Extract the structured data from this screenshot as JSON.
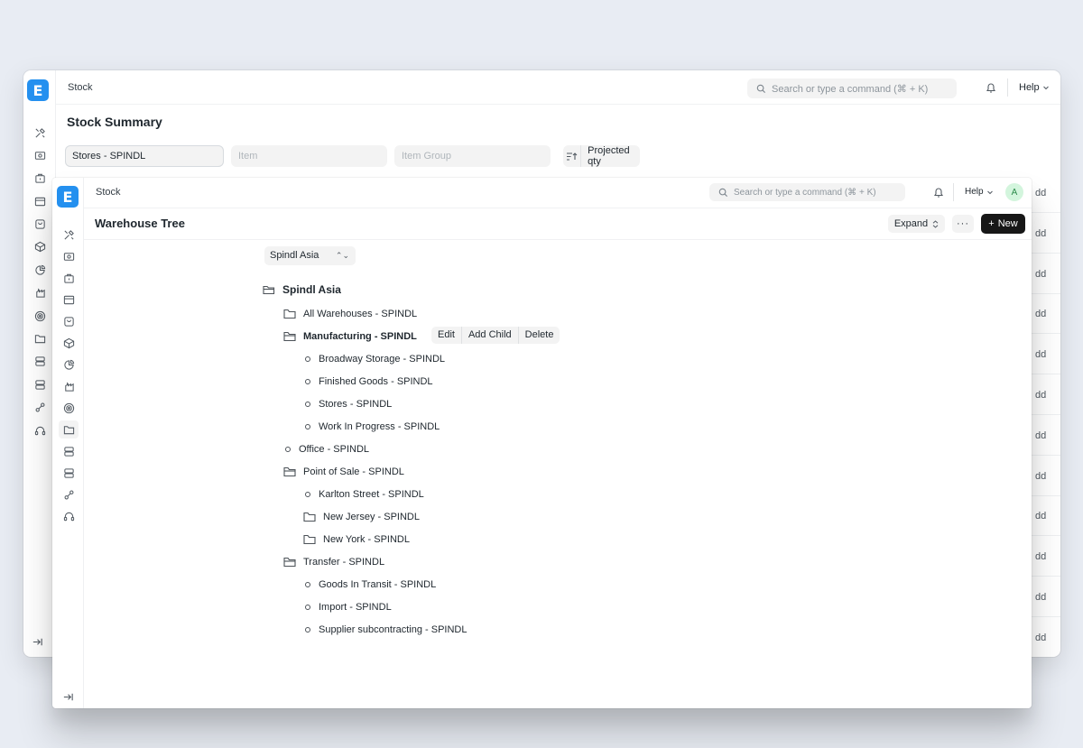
{
  "back_window": {
    "breadcrumb": "Stock",
    "search_placeholder": "Search or type a command (⌘ + K)",
    "help_label": "Help",
    "page_title": "Stock Summary",
    "filters": {
      "warehouse": "Stores - SPINDL",
      "item_placeholder": "Item",
      "item_group_placeholder": "Item Group",
      "sort_label": "Projected qty"
    },
    "add_labels": [
      "dd",
      "dd",
      "dd",
      "dd",
      "dd",
      "dd",
      "dd",
      "dd",
      "dd",
      "dd",
      "dd",
      "dd"
    ]
  },
  "front_window": {
    "breadcrumb": "Stock",
    "search_placeholder": "Search or type a command (⌘ + K)",
    "help_label": "Help",
    "avatar_initial": "A",
    "page_title": "Warehouse Tree",
    "expand_label": "Expand",
    "more_label": "···",
    "new_label": "New",
    "company_select": "Spindl Asia",
    "node_actions": [
      "Edit",
      "Add Child",
      "Delete"
    ],
    "tree": {
      "root": "Spindl Asia",
      "nodes": [
        {
          "label": "All Warehouses - SPINDL",
          "kind": "folder"
        },
        {
          "label": "Manufacturing - SPINDL",
          "kind": "folder-open"
        },
        {
          "label": "Broadway Storage - SPINDL",
          "kind": "leaf"
        },
        {
          "label": "Finished Goods - SPINDL",
          "kind": "leaf"
        },
        {
          "label": "Stores - SPINDL",
          "kind": "leaf"
        },
        {
          "label": "Work In Progress - SPINDL",
          "kind": "leaf"
        },
        {
          "label": "Office - SPINDL",
          "kind": "leaf"
        },
        {
          "label": "Point of Sale - SPINDL",
          "kind": "folder-open"
        },
        {
          "label": "Karlton Street - SPINDL",
          "kind": "leaf"
        },
        {
          "label": "New Jersey - SPINDL",
          "kind": "folder"
        },
        {
          "label": "New York - SPINDL",
          "kind": "folder"
        },
        {
          "label": "Transfer - SPINDL",
          "kind": "folder-open"
        },
        {
          "label": "Goods In Transit - SPINDL",
          "kind": "leaf"
        },
        {
          "label": "Import - SPINDL",
          "kind": "leaf"
        },
        {
          "label": "Supplier subcontracting - SPINDL",
          "kind": "leaf"
        }
      ]
    }
  },
  "colors": {
    "background": "#e8ecf3",
    "brand_logo": "#2490ef",
    "primary_button": "#171717",
    "avatar_bg": "#d3f5dd"
  }
}
